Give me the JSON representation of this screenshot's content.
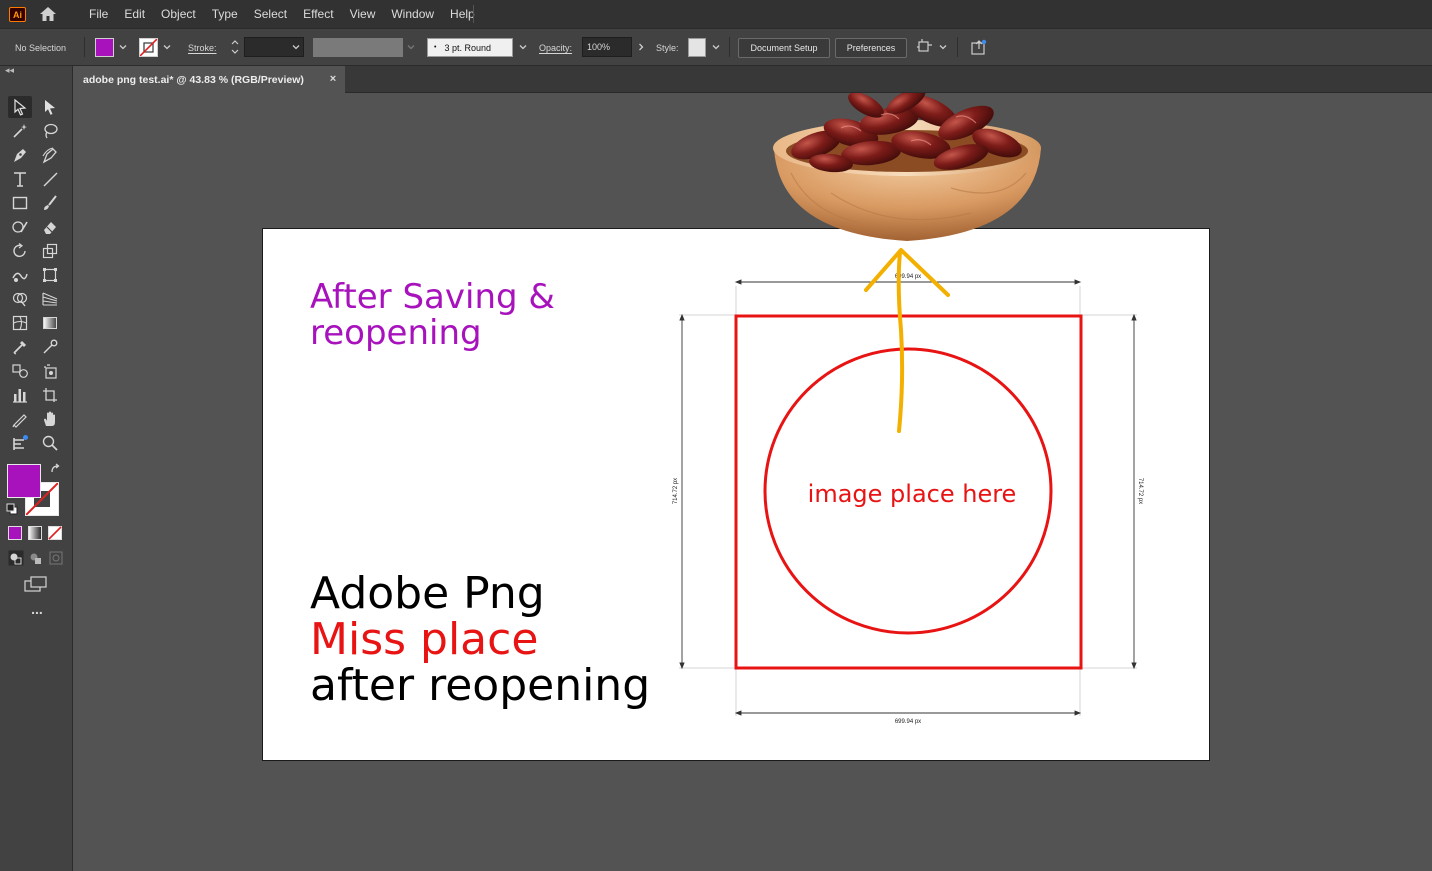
{
  "app": {
    "logo_text": "Ai",
    "menus": [
      "File",
      "Edit",
      "Object",
      "Type",
      "Select",
      "Effect",
      "View",
      "Window",
      "Help"
    ]
  },
  "control_bar": {
    "selection_label": "No Selection",
    "fill_color": "#a812bd",
    "stroke_label": "Stroke:",
    "stroke_weight": "",
    "brush_profile": "3 pt. Round",
    "opacity_label": "Opacity:",
    "opacity_value": "100%",
    "style_label": "Style:",
    "document_setup_label": "Document Setup",
    "preferences_label": "Preferences"
  },
  "document_tab": {
    "title": "adobe png test.ai* @ 43.83 % (RGB/Preview)",
    "close_symbol": "×"
  },
  "tools_panel": {
    "fill_color": "#a812bd",
    "more_tools_label": "..."
  },
  "artboard": {
    "heading_line1": "After Saving &",
    "heading_line2": "reopening",
    "title_line1": "Adobe Png",
    "title_line2": "Miss place",
    "title_line3": "after reopening",
    "placeholder_text": "image place here",
    "dimension_top": "699.94 px",
    "dimension_bottom": "699.94 px",
    "dimension_left": "714.72 px",
    "dimension_right": "714.72 px",
    "colors": {
      "purple": "#a812bd",
      "red": "#e81313",
      "arrow": "#f4b000"
    }
  }
}
